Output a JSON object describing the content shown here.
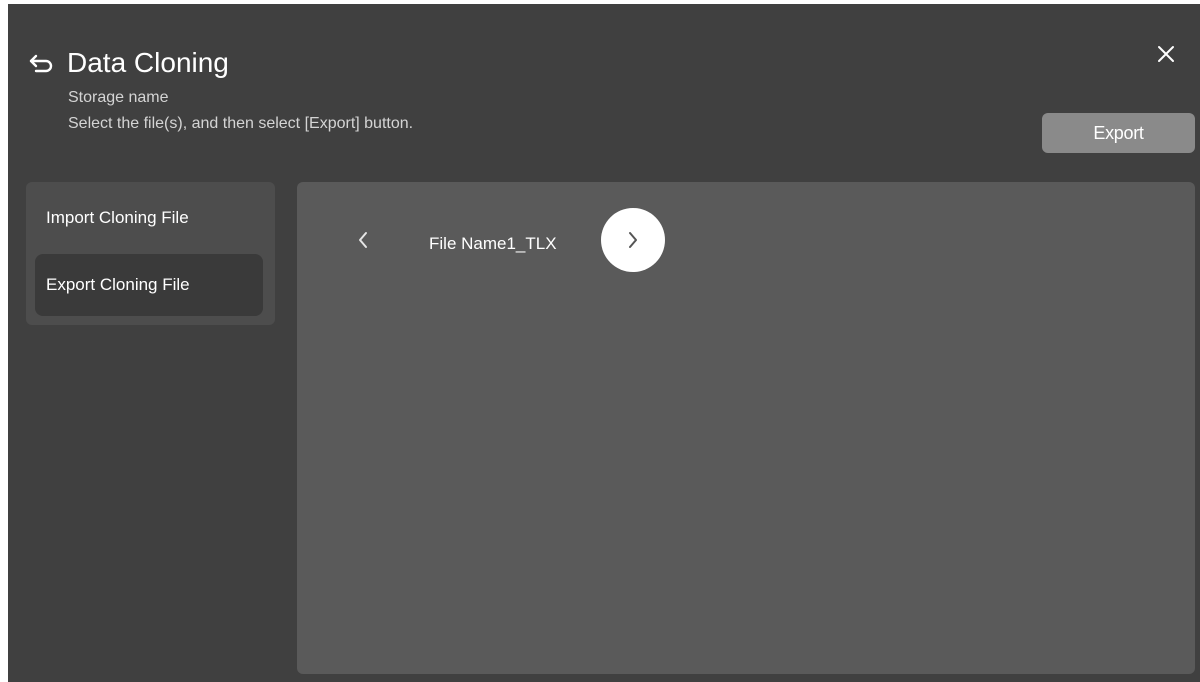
{
  "header": {
    "title": "Data Cloning",
    "subtitle": "Storage name",
    "instruction": "Select the file(s), and then select [Export] button.",
    "back_icon": "back-arrow-icon",
    "close_icon": "close-icon"
  },
  "toolbar": {
    "export_label": "Export"
  },
  "sidebar": {
    "items": [
      {
        "label": "Import Cloning File",
        "selected": false
      },
      {
        "label": "Export Cloning File",
        "selected": true
      }
    ]
  },
  "main": {
    "file_name": "File Name1_TLX",
    "prev_icon": "chevron-left-icon",
    "next_icon": "chevron-right-icon"
  },
  "colors": {
    "background": "#404040",
    "panel": "#5a5a5a",
    "sidebar": "#4d4d4d",
    "selected_item": "#3a3a3a",
    "export_button": "#8a8a8a"
  }
}
